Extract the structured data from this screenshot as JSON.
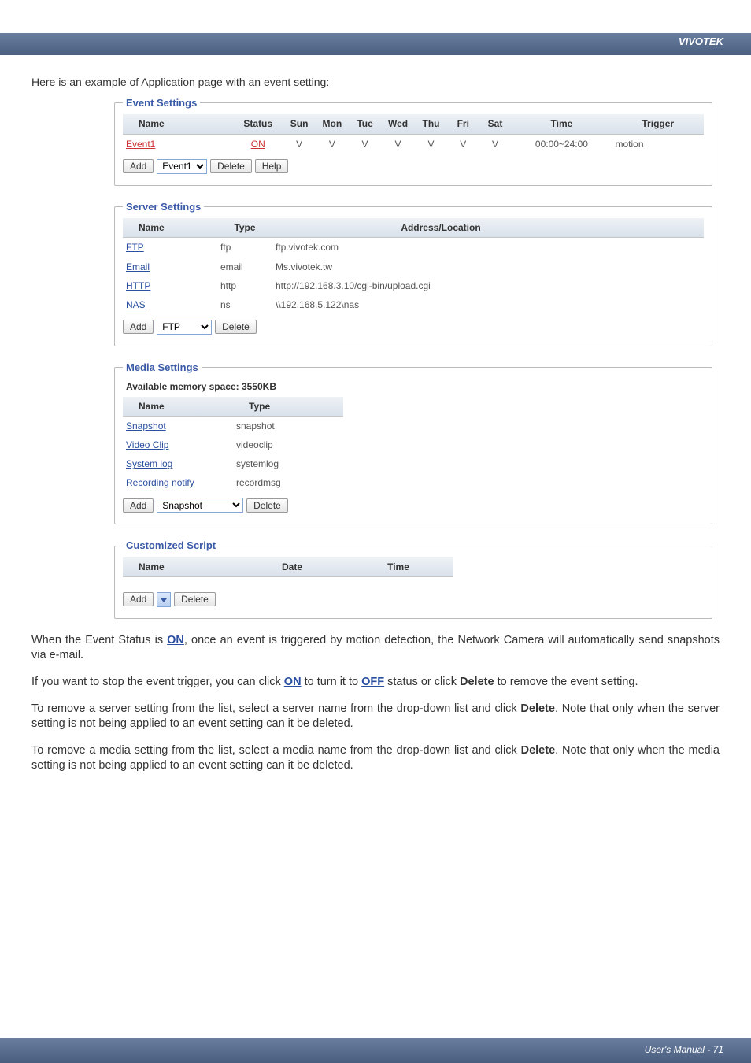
{
  "header": {
    "brand": "VIVOTEK"
  },
  "intro": "Here is an example of Application page with an event setting:",
  "eventSettings": {
    "legend": "Event Settings",
    "headers": [
      "Name",
      "Status",
      "Sun",
      "Mon",
      "Tue",
      "Wed",
      "Thu",
      "Fri",
      "Sat",
      "Time",
      "Trigger"
    ],
    "row": {
      "name": "Event1",
      "status": "ON",
      "days": [
        "V",
        "V",
        "V",
        "V",
        "V",
        "V",
        "V"
      ],
      "time": "00:00~24:00",
      "trigger": "motion"
    },
    "controls": {
      "add": "Add",
      "select": "Event1",
      "delete": "Delete",
      "help": "Help"
    }
  },
  "serverSettings": {
    "legend": "Server Settings",
    "headers": [
      "Name",
      "Type",
      "Address/Location"
    ],
    "rows": [
      {
        "name": "FTP",
        "type": "ftp",
        "addr": "ftp.vivotek.com"
      },
      {
        "name": "Email",
        "type": "email",
        "addr": "Ms.vivotek.tw"
      },
      {
        "name": "HTTP",
        "type": "http",
        "addr": "http://192.168.3.10/cgi-bin/upload.cgi"
      },
      {
        "name": "NAS",
        "type": "ns",
        "addr": "\\\\192.168.5.122\\nas"
      }
    ],
    "controls": {
      "add": "Add",
      "select": "FTP",
      "delete": "Delete"
    }
  },
  "mediaSettings": {
    "legend": "Media Settings",
    "memory": "Available memory space: 3550KB",
    "headers": [
      "Name",
      "Type"
    ],
    "rows": [
      {
        "name": "Snapshot",
        "type": "snapshot"
      },
      {
        "name": "Video Clip",
        "type": "videoclip"
      },
      {
        "name": "System log",
        "type": "systemlog"
      },
      {
        "name": "Recording notify",
        "type": "recordmsg"
      }
    ],
    "controls": {
      "add": "Add",
      "select": "Snapshot",
      "delete": "Delete"
    }
  },
  "customScript": {
    "legend": "Customized Script",
    "headers": [
      "Name",
      "Date",
      "Time"
    ],
    "controls": {
      "add": "Add",
      "delete": "Delete"
    }
  },
  "paras": {
    "p1a": "When the Event Status is ",
    "p1on": "ON",
    "p1b": ", once an event is triggered by motion detection, the Network Camera will automatically send snapshots via e-mail.",
    "p2a": "If you want to stop the event trigger, you can click ",
    "p2on": "ON",
    "p2b": " to turn it to ",
    "p2off": "OFF",
    "p2c": " status or click ",
    "p2del": "Delete",
    "p2d": " to remove the event setting.",
    "p3": "To remove a server setting from the list, select a server name from the drop-down list and click Delete. Note that only when the server setting is not being applied to an event setting can it be deleted.",
    "p4": "To remove a media setting from the list, select a media name from the drop-down list and click Delete. Note that only when the media setting is not being applied to an event setting can it be deleted."
  },
  "footer": {
    "text": "User's Manual - 71"
  }
}
